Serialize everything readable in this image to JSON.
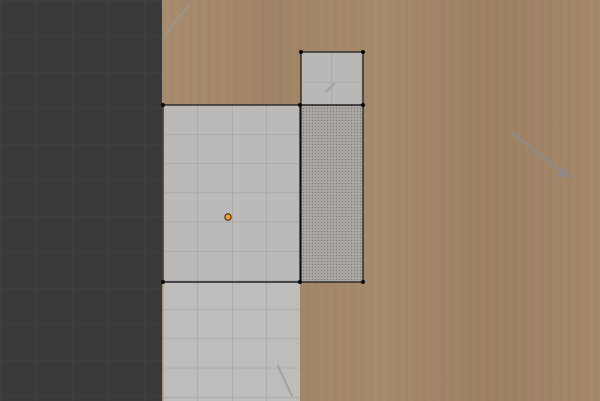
{
  "viewport": {
    "view": "top-orthographic",
    "mode": "edit-mode",
    "selection": "face",
    "colors": {
      "background_grid": "#3a3a3a",
      "grid_line": "#464646",
      "floor_wood": "#a4886a",
      "floor_wood_dark": "#94785c",
      "tile": "#bdbbb9",
      "tile_line": "#9e9c9a",
      "selected_face_fill": "#a6a09c",
      "edge": "#141414",
      "vertex": "#0a0a0a",
      "origin_fill": "#f0a030",
      "origin_stroke": "#3a2400",
      "light_arrow": "#8e8c8c"
    },
    "icons": [
      "object-origin-icon",
      "light-direction-icon"
    ]
  }
}
